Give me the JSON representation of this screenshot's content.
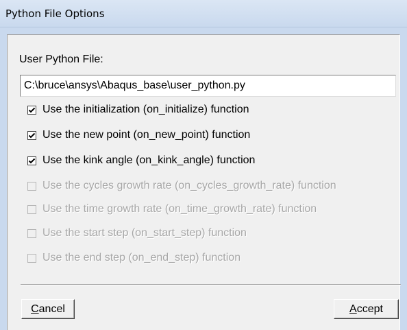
{
  "window": {
    "title": "Python File Options"
  },
  "form": {
    "file_label": "User Python File:",
    "file_path": "C:\\bruce\\ansys\\Abaqus_base\\user_python.py"
  },
  "options": [
    {
      "label": "Use the initialization (on_initialize) function",
      "checked": true,
      "enabled": true
    },
    {
      "label": "Use the new point (on_new_point) function",
      "checked": true,
      "enabled": true
    },
    {
      "label": "Use the kink angle (on_kink_angle) function",
      "checked": true,
      "enabled": true
    },
    {
      "label": "Use the cycles growth rate (on_cycles_growth_rate) function",
      "checked": false,
      "enabled": false
    },
    {
      "label": "Use the time growth rate (on_time_growth_rate) function",
      "checked": false,
      "enabled": false
    },
    {
      "label": "Use the start step (on_start_step) function",
      "checked": false,
      "enabled": false
    },
    {
      "label": "Use the end step (on_end_step) function",
      "checked": false,
      "enabled": false
    }
  ],
  "buttons": {
    "cancel": {
      "mnemonic": "C",
      "rest": "ancel"
    },
    "accept": {
      "mnemonic": "A",
      "rest": "ccept"
    }
  }
}
